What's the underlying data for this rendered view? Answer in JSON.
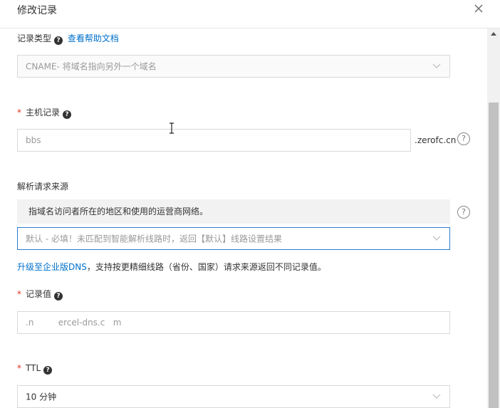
{
  "dialog": {
    "title": "修改记录",
    "close_icon": "close-icon"
  },
  "record_type": {
    "label": "记录类型",
    "help_badge": "?",
    "help_link": "查看帮助文档",
    "value": "CNAME- 将域名指向另外一个域名"
  },
  "host_record": {
    "required_mark": "*",
    "label": "主机记录",
    "help_badge": "?",
    "value": "bbs",
    "suffix": ".zerofc.cn",
    "help_icon": "?"
  },
  "resolve_source": {
    "label": "解析请求来源",
    "hint": "指域名访问者所在的地区和使用的运营商网络。",
    "help_icon": "?",
    "placeholder": "默认 - 必填！未匹配到智能解析线路时，返回【默认】线路设置结果",
    "upgrade_link": "升级至企业版DNS",
    "upgrade_desc": "，支持按更精细线路（省份、国家）请求来源返回不同记录值。"
  },
  "record_value": {
    "required_mark": "*",
    "label": "记录值",
    "help_badge": "?",
    "value": ".n         ercel-dns.c   m"
  },
  "ttl": {
    "required_mark": "*",
    "label": "TTL",
    "help_badge": "?",
    "value": "10 分钟"
  },
  "colors": {
    "link": "#0070cc",
    "required": "#e0301e",
    "focus_border": "#2b7cd3"
  }
}
